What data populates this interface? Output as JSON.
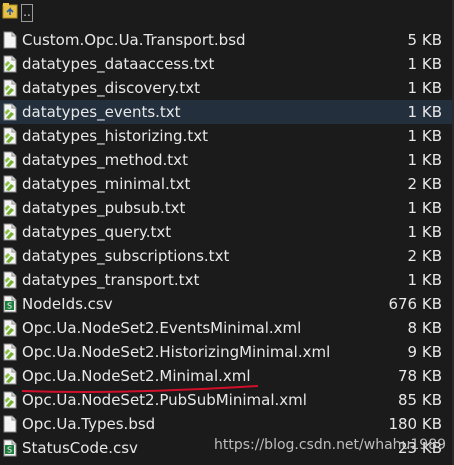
{
  "up": {
    "label": ".."
  },
  "files": [
    {
      "name": "Custom.Opc.Ua.Transport.bsd",
      "size": "5 KB",
      "type": "blank"
    },
    {
      "name": "datatypes_dataaccess.txt",
      "size": "1 KB",
      "type": "txt"
    },
    {
      "name": "datatypes_discovery.txt",
      "size": "1 KB",
      "type": "txt"
    },
    {
      "name": "datatypes_events.txt",
      "size": "1 KB",
      "type": "txt"
    },
    {
      "name": "datatypes_historizing.txt",
      "size": "1 KB",
      "type": "txt"
    },
    {
      "name": "datatypes_method.txt",
      "size": "1 KB",
      "type": "txt"
    },
    {
      "name": "datatypes_minimal.txt",
      "size": "2 KB",
      "type": "txt"
    },
    {
      "name": "datatypes_pubsub.txt",
      "size": "1 KB",
      "type": "txt"
    },
    {
      "name": "datatypes_query.txt",
      "size": "1 KB",
      "type": "txt"
    },
    {
      "name": "datatypes_subscriptions.txt",
      "size": "2 KB",
      "type": "txt"
    },
    {
      "name": "datatypes_transport.txt",
      "size": "1 KB",
      "type": "txt"
    },
    {
      "name": "NodeIds.csv",
      "size": "676 KB",
      "type": "csv"
    },
    {
      "name": "Opc.Ua.NodeSet2.EventsMinimal.xml",
      "size": "8 KB",
      "type": "txt"
    },
    {
      "name": "Opc.Ua.NodeSet2.HistorizingMinimal.xml",
      "size": "9 KB",
      "type": "txt"
    },
    {
      "name": "Opc.Ua.NodeSet2.Minimal.xml",
      "size": "78 KB",
      "type": "txt"
    },
    {
      "name": "Opc.Ua.NodeSet2.PubSubMinimal.xml",
      "size": "85 KB",
      "type": "txt"
    },
    {
      "name": "Opc.Ua.Types.bsd",
      "size": "180 KB",
      "type": "blank"
    },
    {
      "name": "StatusCode.csv",
      "size": "23 KB",
      "type": "csv"
    }
  ],
  "selected_index": 3,
  "watermark": "https://blog.csdn.net/whahu1989",
  "colors": {
    "background": "#1b1b1b",
    "selected_row": "#232f3d",
    "annotation_underline": "#d0102a"
  }
}
